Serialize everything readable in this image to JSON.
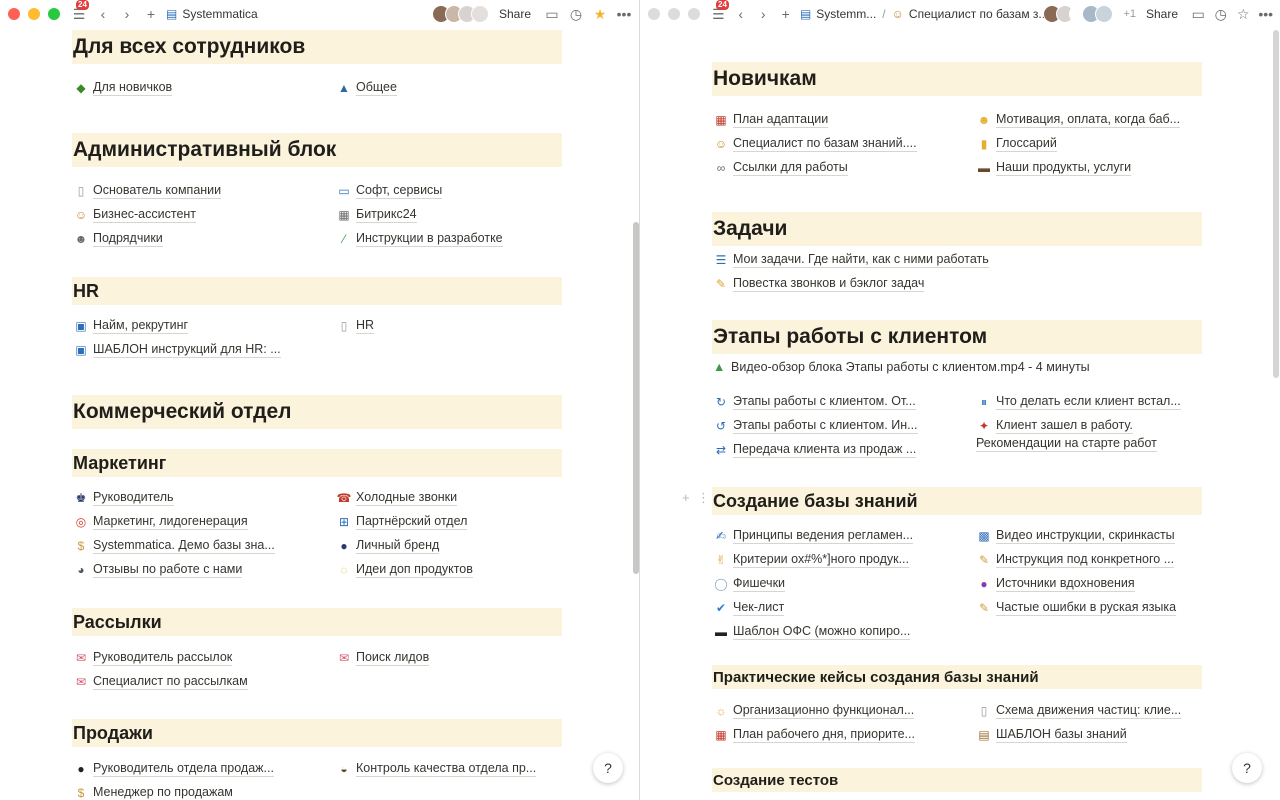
{
  "left": {
    "notification_count": "24",
    "crumb_title": "Systemmatica",
    "share_label": "Share",
    "sections": {
      "all_staff": "Для всех сотрудников",
      "admin": "Административный блок",
      "hr": "HR",
      "commercial": "Коммерческий отдел",
      "marketing": "Маркетинг",
      "mailings": "Рассылки",
      "sales": "Продажи"
    },
    "links": {
      "newbies": "Для новичков",
      "general": "Общее",
      "founder": "Основатель компании",
      "soft": "Софт, сервисы",
      "biz_assistant": "Бизнес-ассистент",
      "bitrix": "Битрикс24",
      "contractors": "Подрядчики",
      "instructions_dev": "Инструкции в разработке",
      "hiring": "Найм, рекрутинг",
      "hr_page": "HR",
      "hr_template": "ШАБЛОН инструкций для HR: ...",
      "head": "Руководитель",
      "cold_calls": "Холодные звонки",
      "marketing_leadgen": "Маркетинг, лидогенерация",
      "partners": "Партнёрский отдел",
      "demo": "Systemmatica. Демо базы зна...",
      "brand": "Личный бренд",
      "reviews": "Отзывы по работе с нами",
      "ideas": "Идеи доп продуктов",
      "mail_head": "Руководитель рассылок",
      "lead_search": "Поиск лидов",
      "mail_specialist": "Специалист по рассылкам",
      "sales_head": "Руководитель отдела продаж...",
      "sales_qc": "Контроль качества отдела пр...",
      "sales_manager": "Менеджер по продажам"
    }
  },
  "right": {
    "notification_count": "24",
    "crumb_1": "Systemm...",
    "crumb_2": "Специалист по базам з...",
    "extra_count": "+1",
    "share_label": "Share",
    "sections": {
      "newbies": "Новичкам",
      "tasks": "Задачи",
      "stages": "Этапы работы с клиентом",
      "kb_creation": "Создание базы знаний",
      "cases": "Практические кейсы создания базы знаний",
      "tests": "Создание тестов"
    },
    "links": {
      "adaptation": "План адаптации",
      "motivation": "Мотивация, оплата, когда баб...",
      "kb_specialist": "Специалист по базам знаний....",
      "glossary": "Глоссарий",
      "work_links": "Ссылки для работы",
      "products": "Наши продукты, услуги",
      "my_tasks": "Мои задачи. Где найти, как с ними работать",
      "agenda": "Повестка звонков и бэклог задач",
      "video_overview": "Видео-обзор блока Этапы работы с клиентом.mp4 - 4 минуты",
      "stages_1": "Этапы работы с клиентом. От...",
      "stuck_client": "Что делать если клиент встал...",
      "stages_2": "Этапы работы с клиентом. Ин...",
      "client_started_1": "Клиент зашел в работу.",
      "client_started_2": "Рекомендации на старте работ",
      "handover": "Передача клиента из продаж ...",
      "principles": "Принципы ведения регламен...",
      "video_instructions": "Видео инструкции, скринкасты",
      "criteria": "Критерии ох#%*]ного продук...",
      "specific_instruction": "Инструкция под конкретного ...",
      "tricks": "Фишечки",
      "inspiration": "Источники вдохновения",
      "checklist": "Чек-лист",
      "mistakes": "Частые ошибки в руская языка",
      "ofs_template": "Шаблон ОФС (можно копиро...",
      "org_functional": "Организационно функционал...",
      "particles": "Схема движения частиц: клие...",
      "workday": "План рабочего дня, приорите...",
      "kb_template": "ШАБЛОН базы знаний"
    }
  },
  "help_label": "?"
}
